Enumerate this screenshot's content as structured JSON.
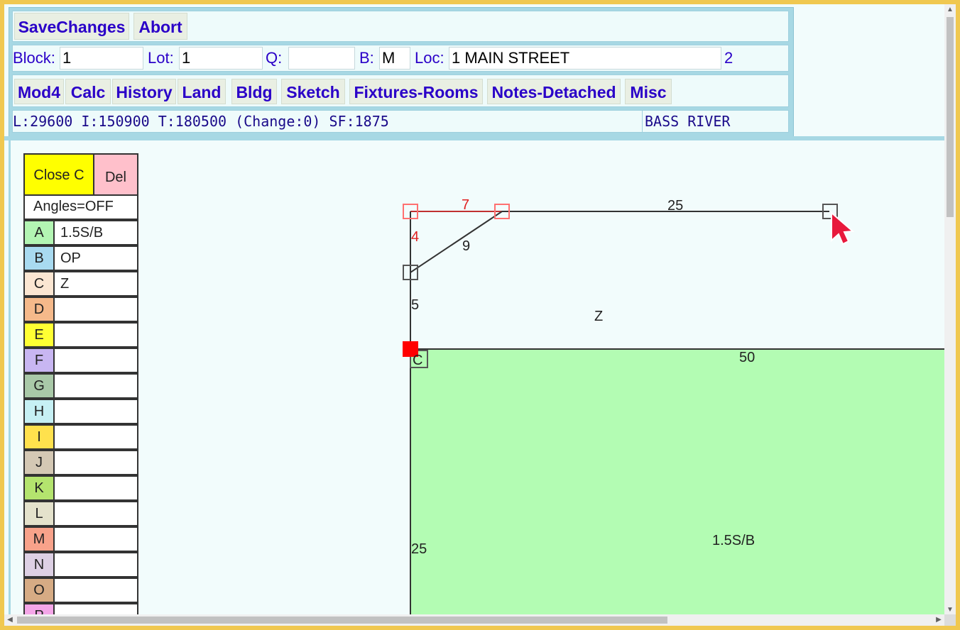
{
  "toolbar": {
    "save_label": "SaveChanges",
    "abort_label": "Abort"
  },
  "fields": {
    "block_label": "Block:",
    "block_value": "1",
    "lot_label": "Lot:",
    "lot_value": "1",
    "q_label": "Q:",
    "q_value": "",
    "b_label": "B:",
    "b_value": "M",
    "loc_label": "Loc:",
    "loc_value": "1 MAIN STREET",
    "card_number": "2"
  },
  "nav": {
    "mod4": "Mod4",
    "calc": "Calc",
    "history": "History",
    "land": "Land",
    "bldg": "Bldg",
    "sketch": "Sketch",
    "fixtures": "Fixtures-Rooms",
    "notes": "Notes-Detached",
    "misc": "Misc"
  },
  "summary": {
    "values": "L:29600 I:150900 T:180500 (Change:0) SF:1875",
    "town": "BASS RIVER"
  },
  "panel": {
    "close_label": "Close C",
    "del_label": "Del",
    "angles_label": "Angles=OFF",
    "codes": [
      {
        "letter": "A",
        "desc": "1.5S/B",
        "color": "#b3f5b3"
      },
      {
        "letter": "B",
        "desc": "OP",
        "color": "#a8daf0"
      },
      {
        "letter": "C",
        "desc": "Z",
        "color": "#fbe6d2"
      },
      {
        "letter": "D",
        "desc": "",
        "color": "#f5b98a"
      },
      {
        "letter": "E",
        "desc": "",
        "color": "#ffff33"
      },
      {
        "letter": "F",
        "desc": "",
        "color": "#c8b6f2"
      },
      {
        "letter": "G",
        "desc": "",
        "color": "#a9c9a8"
      },
      {
        "letter": "H",
        "desc": "",
        "color": "#c6f0f4"
      },
      {
        "letter": "I",
        "desc": "",
        "color": "#ffe14d"
      },
      {
        "letter": "J",
        "desc": "",
        "color": "#d4c8b4"
      },
      {
        "letter": "K",
        "desc": "",
        "color": "#b4e46e"
      },
      {
        "letter": "L",
        "desc": "",
        "color": "#e4e2cc"
      },
      {
        "letter": "M",
        "desc": "",
        "color": "#f8a28a"
      },
      {
        "letter": "N",
        "desc": "",
        "color": "#ddd0e4"
      },
      {
        "letter": "O",
        "desc": "",
        "color": "#d6ab84"
      },
      {
        "letter": "P",
        "desc": "",
        "color": "#f4a6e8"
      }
    ]
  },
  "drawing": {
    "labels": {
      "top_seg_red": "7",
      "top_seg": "25",
      "left_red": "4",
      "diag": "9",
      "left_mid": "5",
      "area_z": "Z",
      "corner_c": "C",
      "green_top": "50",
      "green_left": "25",
      "green_area": "1.5S/B"
    },
    "colors": {
      "green_area": "#b3fcb3",
      "red_marker": "#ff0000",
      "red_outline": "#ff7070",
      "red_text": "#e02020"
    }
  }
}
